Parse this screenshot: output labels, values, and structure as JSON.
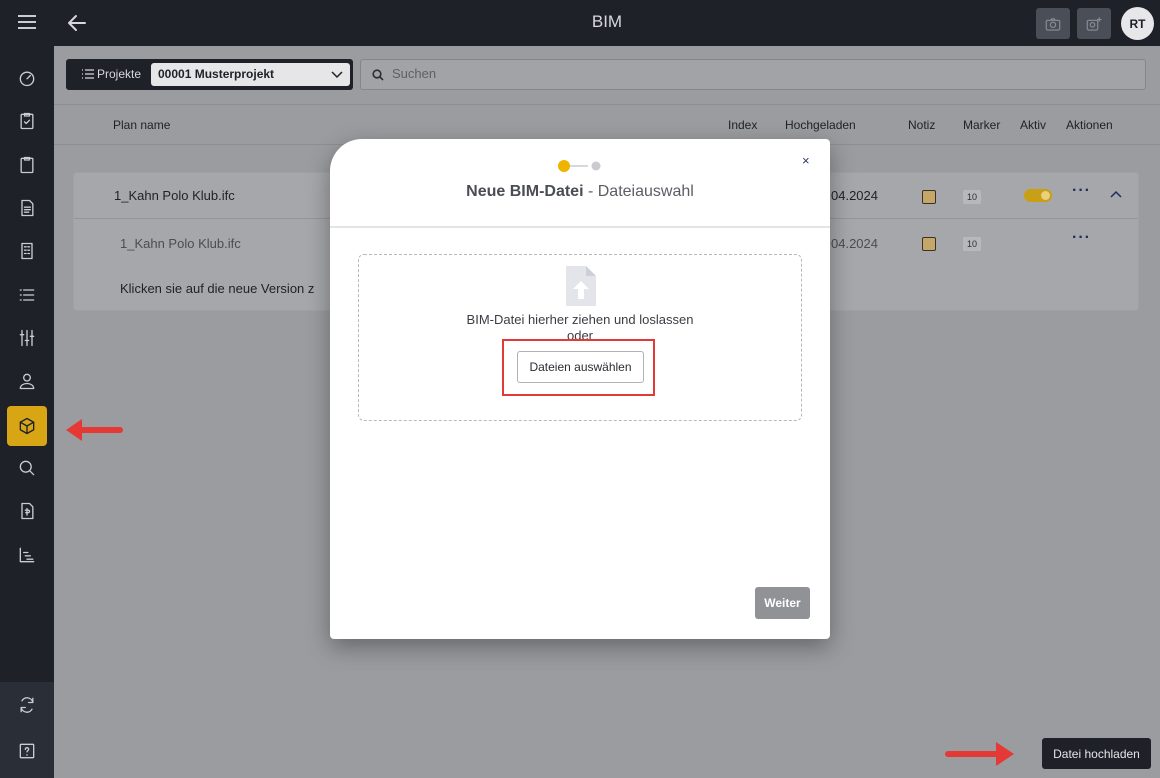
{
  "app": {
    "title": "BIM"
  },
  "topbar": {
    "avatar_initials": "RT"
  },
  "filter": {
    "projects_label": "Projekte",
    "selected_project": "00001 Musterprojekt",
    "search_placeholder": "Suchen"
  },
  "table": {
    "columns": [
      "Plan name",
      "Index",
      "Hochgeladen",
      "Notiz",
      "Marker",
      "Aktiv",
      "Aktionen"
    ],
    "rows": [
      {
        "name": "1_Kahn Polo Klub.ifc",
        "uploaded": "04.2024",
        "marker": "10"
      },
      {
        "name": "1_Kahn Polo Klub.ifc",
        "uploaded": "04.2024",
        "marker": "10"
      }
    ],
    "hint": "Klicken sie auf die neue Version z"
  },
  "modal": {
    "title_bold": "Neue BIM-Datei",
    "title_rest": " - Dateiauswahl",
    "close": "×",
    "drop_text_1": "BIM-Datei hierher ziehen und loslassen",
    "drop_text_2": "oder",
    "choose_button": "Dateien auswählen",
    "next_button": "Weiter"
  },
  "bottom": {
    "upload_button": "Datei hochladen"
  },
  "colors": {
    "accent": "#d8a614",
    "dark": "#1e2128",
    "highlight": "#e53935"
  }
}
